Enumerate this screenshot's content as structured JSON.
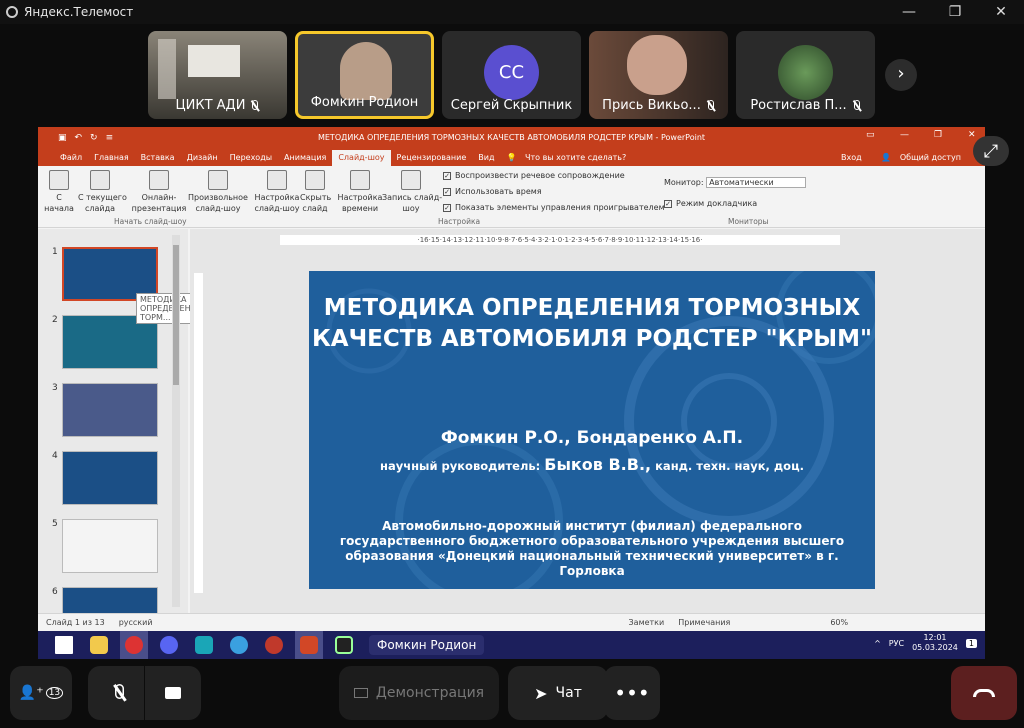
{
  "window": {
    "title": "Яндекс.Телемост"
  },
  "participants": [
    {
      "name": "ЦИКТ АДИ",
      "muted": true
    },
    {
      "name": "Фомкин Родион",
      "muted": false,
      "active": true
    },
    {
      "name": "Сергей Скрыпник",
      "initials": "СС",
      "muted": false
    },
    {
      "name": "Прись Викьо...",
      "muted": true
    },
    {
      "name": "Ростислав П...",
      "muted": true
    }
  ],
  "powerpoint": {
    "title": "МЕТОДИКА ОПРЕДЕЛЕНИЯ ТОРМОЗНЫХ КАЧЕСТВ АВТОМОБИЛЯ РОДСТЕР КРЫМ - PowerPoint",
    "menu": [
      "Файл",
      "Главная",
      "Вставка",
      "Дизайн",
      "Переходы",
      "Анимация",
      "Слайд-шоу",
      "Рецензирование",
      "Вид"
    ],
    "menu_selected": "Слайд-шоу",
    "tell_me": "Что вы хотите сделать?",
    "login": "Вход",
    "share": "Общий доступ",
    "ribbon": {
      "from_start": "С\nначала",
      "from_current": "С текущего\nслайда",
      "online": "Онлайн-\nпрезентация",
      "custom": "Произвольное\nслайд-шоу",
      "setup": "Настройка\nслайд-шоу",
      "hide": "Скрыть\nслайд",
      "timing": "Настройка\nвремени",
      "record": "Запись слайд-\nшоу",
      "group_start": "Начать слайд-шоу",
      "group_setup": "Настройка",
      "group_monitors": "Мониторы",
      "chk_narration": "Воспроизвести речевое сопровождение",
      "chk_timings": "Использовать время",
      "chk_controls": "Показать элементы управления проигрывателем",
      "monitor_label": "Монитор:",
      "monitor_value": "Автоматически",
      "presenter_view": "Режим докладчика"
    },
    "ruler": "·16·15·14·13·12·11·10·9·8·7·6·5·4·3·2·1·0·1·2·3·4·5·6·7·8·9·10·11·12·13·14·15·16·",
    "tooltip": "МЕТОДИКА ОПРЕДЕЛЕНИЯ ТОРМ...",
    "slide_numbers": [
      "1",
      "2",
      "3",
      "4",
      "5",
      "6"
    ],
    "slide": {
      "title": "МЕТОДИКА ОПРЕДЕЛЕНИЯ ТОРМОЗНЫХ КАЧЕСТВ АВТОМОБИЛЯ РОДСТЕР \"КРЫМ\"",
      "authors": "Фомкин Р.О., Бондаренко А.П.",
      "supervisor_label": "научный руководитель:",
      "supervisor_name": "Быков В.В.,",
      "supervisor_title": "канд. техн. наук, доц.",
      "institution": "Автомобильно-дорожный институт (филиал) федерального государственного бюджетного образовательного учреждения высшего образования «Донецкий национальный технический университет» в г. Горловка"
    },
    "status": {
      "slide": "Слайд 1 из 13",
      "lang": "русский",
      "notes": "Заметки",
      "comments": "Примечания",
      "zoom": "60%"
    }
  },
  "taskbar": {
    "active_window": "Фомкин Родион",
    "lang": "РУС",
    "time": "12:01",
    "date": "05.03.2024",
    "badge": "1"
  },
  "controls": {
    "participants_count": "13",
    "demo": "Демонстрация",
    "chat": "Чат"
  },
  "colors": {
    "accent": "#f6c82b",
    "ppt": "#c43e1c",
    "slide_bg": "#1f5f9c",
    "leave": "#6b2222"
  }
}
